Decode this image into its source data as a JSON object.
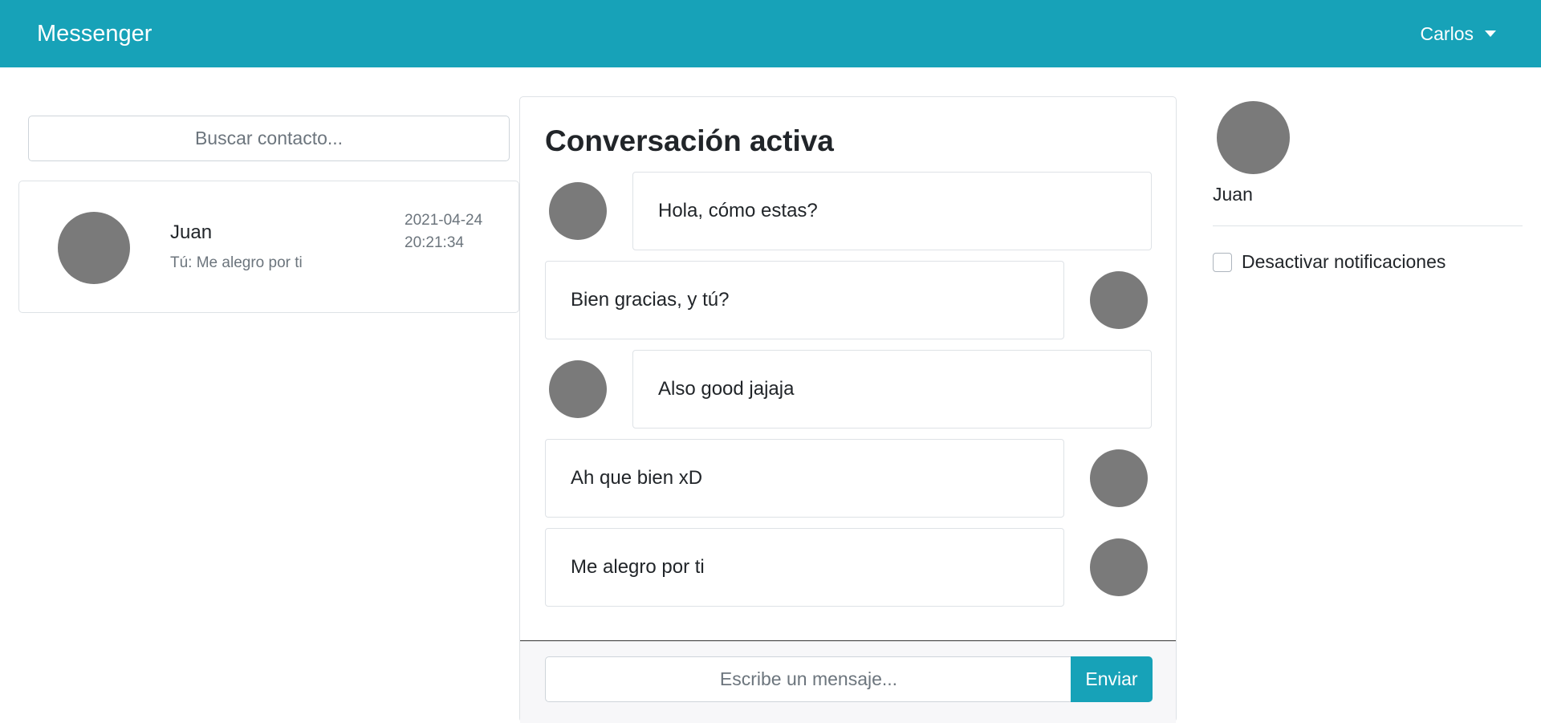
{
  "navbar": {
    "brand": "Messenger",
    "user": "Carlos",
    "accent_color": "#17a2b8"
  },
  "contacts": {
    "search_placeholder": "Buscar contacto...",
    "items": [
      {
        "name": "Juan",
        "preview": "Tú: Me alegro por ti",
        "date": "2021-04-24",
        "time": "20:21:34"
      }
    ]
  },
  "chat": {
    "title": "Conversación activa",
    "messages": [
      {
        "text": "Hola, cómo estas?",
        "direction": "received"
      },
      {
        "text": "Bien gracias, y tú?",
        "direction": "sent"
      },
      {
        "text": "Also good jajaja",
        "direction": "received"
      },
      {
        "text": "Ah que bien xD",
        "direction": "sent"
      },
      {
        "text": "Me alegro por ti",
        "direction": "sent"
      }
    ],
    "input_placeholder": "Escribe un mensaje...",
    "send_label": "Enviar"
  },
  "profile": {
    "name": "Juan",
    "notifications_label": "Desactivar notificaciones",
    "notifications_checked": false
  }
}
